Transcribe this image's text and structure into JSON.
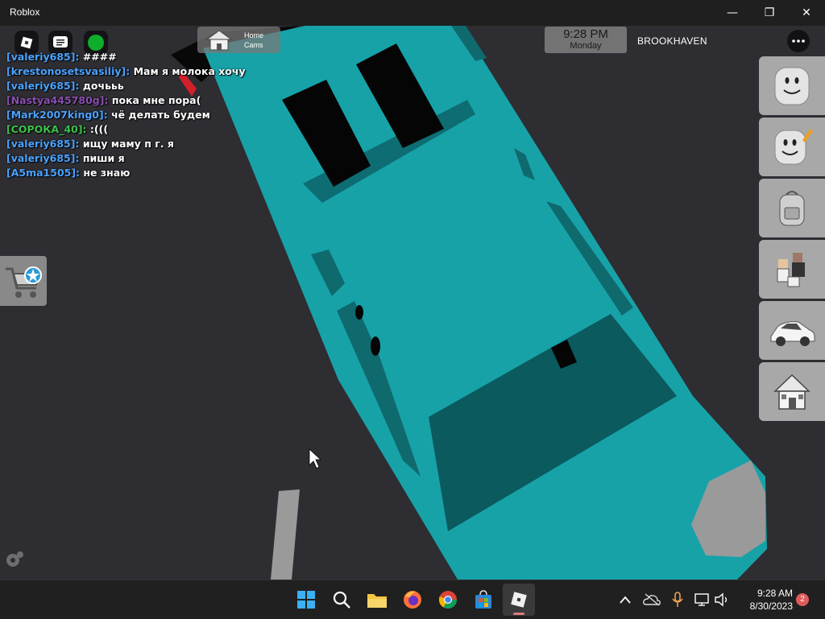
{
  "window": {
    "title": "Roblox",
    "minimize_label": "—",
    "maximize_label": "❐",
    "close_label": "✕"
  },
  "hud": {
    "home_cams_label_1": "Home",
    "home_cams_label_2": "Cams",
    "clock_time": "9:28 PM",
    "clock_day": "Monday",
    "place_name": "BROOKHAVEN"
  },
  "chat": {
    "lines": [
      {
        "user": "[valeriy685]:",
        "text": "####",
        "user_color": "#4aa3ff"
      },
      {
        "user": "[krestonosetsvasiliy]:",
        "text": "Мам я молока хочу",
        "user_color": "#4aa3ff"
      },
      {
        "user": "[valeriy685]:",
        "text": "дочььь",
        "user_color": "#4aa3ff"
      },
      {
        "user": "[Nastya445780g]:",
        "text": "пока мне пора(",
        "user_color": "#8a4fb0"
      },
      {
        "user": "[Mark2007king0]:",
        "text": "чё делать будем",
        "user_color": "#4aa3ff"
      },
      {
        "user": "[СОРОКА_40]:",
        "text": ":(((",
        "user_color": "#3cc34a"
      },
      {
        "user": "[valeriy685]:",
        "text": "ищу маму п г. я",
        "user_color": "#4aa3ff"
      },
      {
        "user": "[valeriy685]:",
        "text": "пиши я",
        "user_color": "#4aa3ff"
      },
      {
        "user": "[A5ma1505]:",
        "text": "не знаю",
        "user_color": "#4aa3ff"
      }
    ]
  },
  "taskbar": {
    "clock_time": "9:28 AM",
    "clock_date": "8/30/2023",
    "notification_count": "2"
  },
  "colors": {
    "car_body": "#17a2a8",
    "car_shadow": "#0f6a6e",
    "ground": "#2e2d32",
    "taskbar": "#202020"
  }
}
